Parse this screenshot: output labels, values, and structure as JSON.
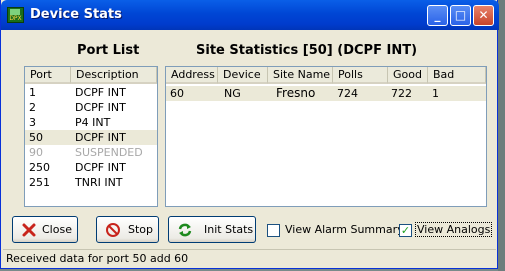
{
  "window": {
    "title": "Device Stats",
    "icon_caption": "DPX"
  },
  "titlebar_buttons": {
    "minimize": "_",
    "maximize": "□",
    "close": "✕"
  },
  "port_list": {
    "title": "Port List",
    "columns": [
      "Port",
      "Description"
    ],
    "rows": [
      {
        "port": "1",
        "description": "DCPF INT"
      },
      {
        "port": "2",
        "description": "DCPF INT"
      },
      {
        "port": "3",
        "description": "P4 INT"
      },
      {
        "port": "50",
        "description": "DCPF INT"
      },
      {
        "port": "90",
        "description": "SUSPENDED"
      },
      {
        "port": "250",
        "description": "DCPF INT"
      },
      {
        "port": "251",
        "description": "TNRI INT"
      }
    ],
    "selected_index": 3
  },
  "site_stats": {
    "title": "Site Statistics [50] (DCPF INT)",
    "columns": [
      "Address",
      "Device",
      "Site Name",
      "Polls",
      "Good",
      "Bad"
    ],
    "rows": [
      {
        "address": "60",
        "device": "NG",
        "site_name": "Fresno",
        "polls": "724",
        "good": "722",
        "bad": "1"
      }
    ]
  },
  "buttons": {
    "close": {
      "label": "Close",
      "icon": "red-x-icon"
    },
    "stop": {
      "label": "Stop",
      "icon": "no-entry-icon"
    },
    "init_stats": {
      "label": "Init Stats",
      "icon": "refresh-icon"
    }
  },
  "checkboxes": {
    "view_alarm_summary": {
      "label": "View Alarm Summary",
      "checked": false
    },
    "view_analogs": {
      "label": "View Analogs",
      "checked": true
    }
  },
  "status_bar": {
    "text": "Received data for port 50 add 60"
  },
  "colors": {
    "title_bar": "#0046d5",
    "dialog_bg": "#ece9d8",
    "selected_row": "#ebe9d8",
    "disabled_text": "#a8a8a8"
  }
}
